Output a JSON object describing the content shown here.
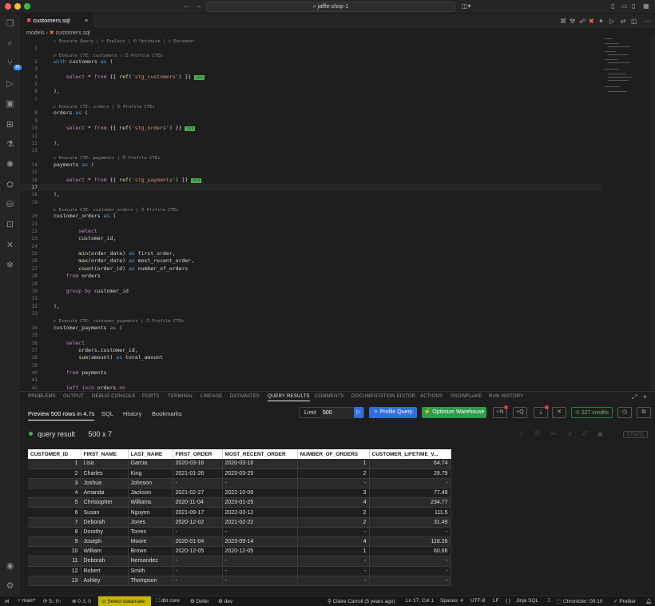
{
  "titlebar": {
    "search": "jaffle-shop-1",
    "colors": {
      "close": "#ff5f57",
      "minimize": "#febc2e",
      "maximize": "#28c840"
    }
  },
  "activity": {
    "source_control_badge": "12"
  },
  "tab": {
    "file": "customers.sql"
  },
  "breadcrumb": {
    "folder": "models",
    "file": "customers.sql"
  },
  "codelens": {
    "file": "▷ Execute Query | ✎ Explain | ⟲ Optimize | ☐ Document",
    "customers": "▷ Execute CTE: customers | ⏱ Profile CTEs",
    "orders": "▷ Execute CTE: orders | ⏱ Profile CTEs",
    "payments": "▷ Execute CTE: payments | ⏱ Profile CTEs",
    "customer_orders": "▷ Execute CTE: customer_orders | ⏱ Profile CTEs",
    "customer_payments": "▷ Execute CTE: customer_payments | ⏱ Profile CTEs"
  },
  "code": {
    "customers_ref": "'stg_customers'",
    "orders_ref": "'stg_orders'",
    "payments_ref": "'stg_payments'"
  },
  "panel": {
    "tabs": [
      "PROBLEMS",
      "OUTPUT",
      "DEBUG CONSOLE",
      "PORTS",
      "TERMINAL",
      "LINEAGE",
      "DATAMATES",
      "QUERY RESULTS",
      "COMMENTS",
      "DOCUMENTATION EDITOR",
      "ACTIONS",
      "SNOWFLAKE",
      "RUN HISTORY"
    ],
    "active_tab": "QUERY RESULTS"
  },
  "query": {
    "preview_tab": "Preview 500 rows in 4.7s",
    "sql_tab": "SQL",
    "history_tab": "History",
    "bookmarks_tab": "Bookmarks",
    "limit_label": "Limit",
    "limit_value": "500",
    "profile_button": "Profile Query",
    "optimize_button": "Optimize Warehouse",
    "credits": "227 credits",
    "n_button": "+N",
    "q_button": "+Q",
    "result_label": "query result",
    "result_dims": "500 x 7",
    "charts_button": "Charts"
  },
  "table": {
    "headers": [
      "CUSTOMER_ID",
      "FIRST_NAME",
      "LAST_NAME",
      "FIRST_ORDER",
      "MOST_RECENT_ORDER",
      "NUMBER_OF_ORDERS",
      "CUSTOMER_LIFETIME_V..."
    ],
    "rows": [
      [
        "1",
        "Lisa",
        "Garcia",
        "2020-03-16",
        "2020-03-16",
        "1",
        "64.74"
      ],
      [
        "2",
        "Charles",
        "King",
        "2021-01-26",
        "2023-03-25",
        "2",
        "29.79"
      ],
      [
        "3",
        "Joshua",
        "Johnson",
        "-",
        "-",
        "-",
        "-"
      ],
      [
        "4",
        "Amanda",
        "Jackson",
        "2021-02-27",
        "2022-10-06",
        "3",
        "77.49"
      ],
      [
        "5",
        "Christopher",
        "Williams",
        "2020-11-04",
        "2023-01-25",
        "4",
        "234.77"
      ],
      [
        "6",
        "Susan",
        "Nguyen",
        "2021-09-17",
        "2022-03-12",
        "2",
        "111.5"
      ],
      [
        "7",
        "Deborah",
        "Jones",
        "2020-12-02",
        "2021-02-22",
        "2",
        "31.49"
      ],
      [
        "8",
        "Dorothy",
        "Torres",
        "-",
        "-",
        "-",
        "-"
      ],
      [
        "9",
        "Joseph",
        "Moore",
        "2020-01-04",
        "2023-09-14",
        "4",
        "118.26"
      ],
      [
        "10",
        "William",
        "Brown",
        "2020-12-05",
        "2020-12-05",
        "1",
        "60.66"
      ],
      [
        "11",
        "Deborah",
        "Hernandez",
        "-",
        "-",
        "-",
        "-"
      ],
      [
        "12",
        "Robert",
        "Smith",
        "-",
        "-",
        "-",
        "-"
      ],
      [
        "13",
        "Ashley",
        "Thompson",
        "-",
        "-",
        "-",
        "-"
      ]
    ]
  },
  "status": {
    "branch": "main*",
    "sync": "5↓ 0↑",
    "problems": "⊗ 0 ⚠ 0",
    "datamate": "Select datamate",
    "dbt": "dbt core",
    "defer": "Defer",
    "env": "dev",
    "blame": "Claire Carroll (5 years ago)",
    "position": "Ln 17, Col 1",
    "spaces": "Spaces: 4",
    "encoding": "UTF-8",
    "eol": "LF",
    "braces": "{ }",
    "language": "Jinja SQL",
    "chronicler": "Chronicler: 00:10",
    "prettier": "Prettier"
  }
}
